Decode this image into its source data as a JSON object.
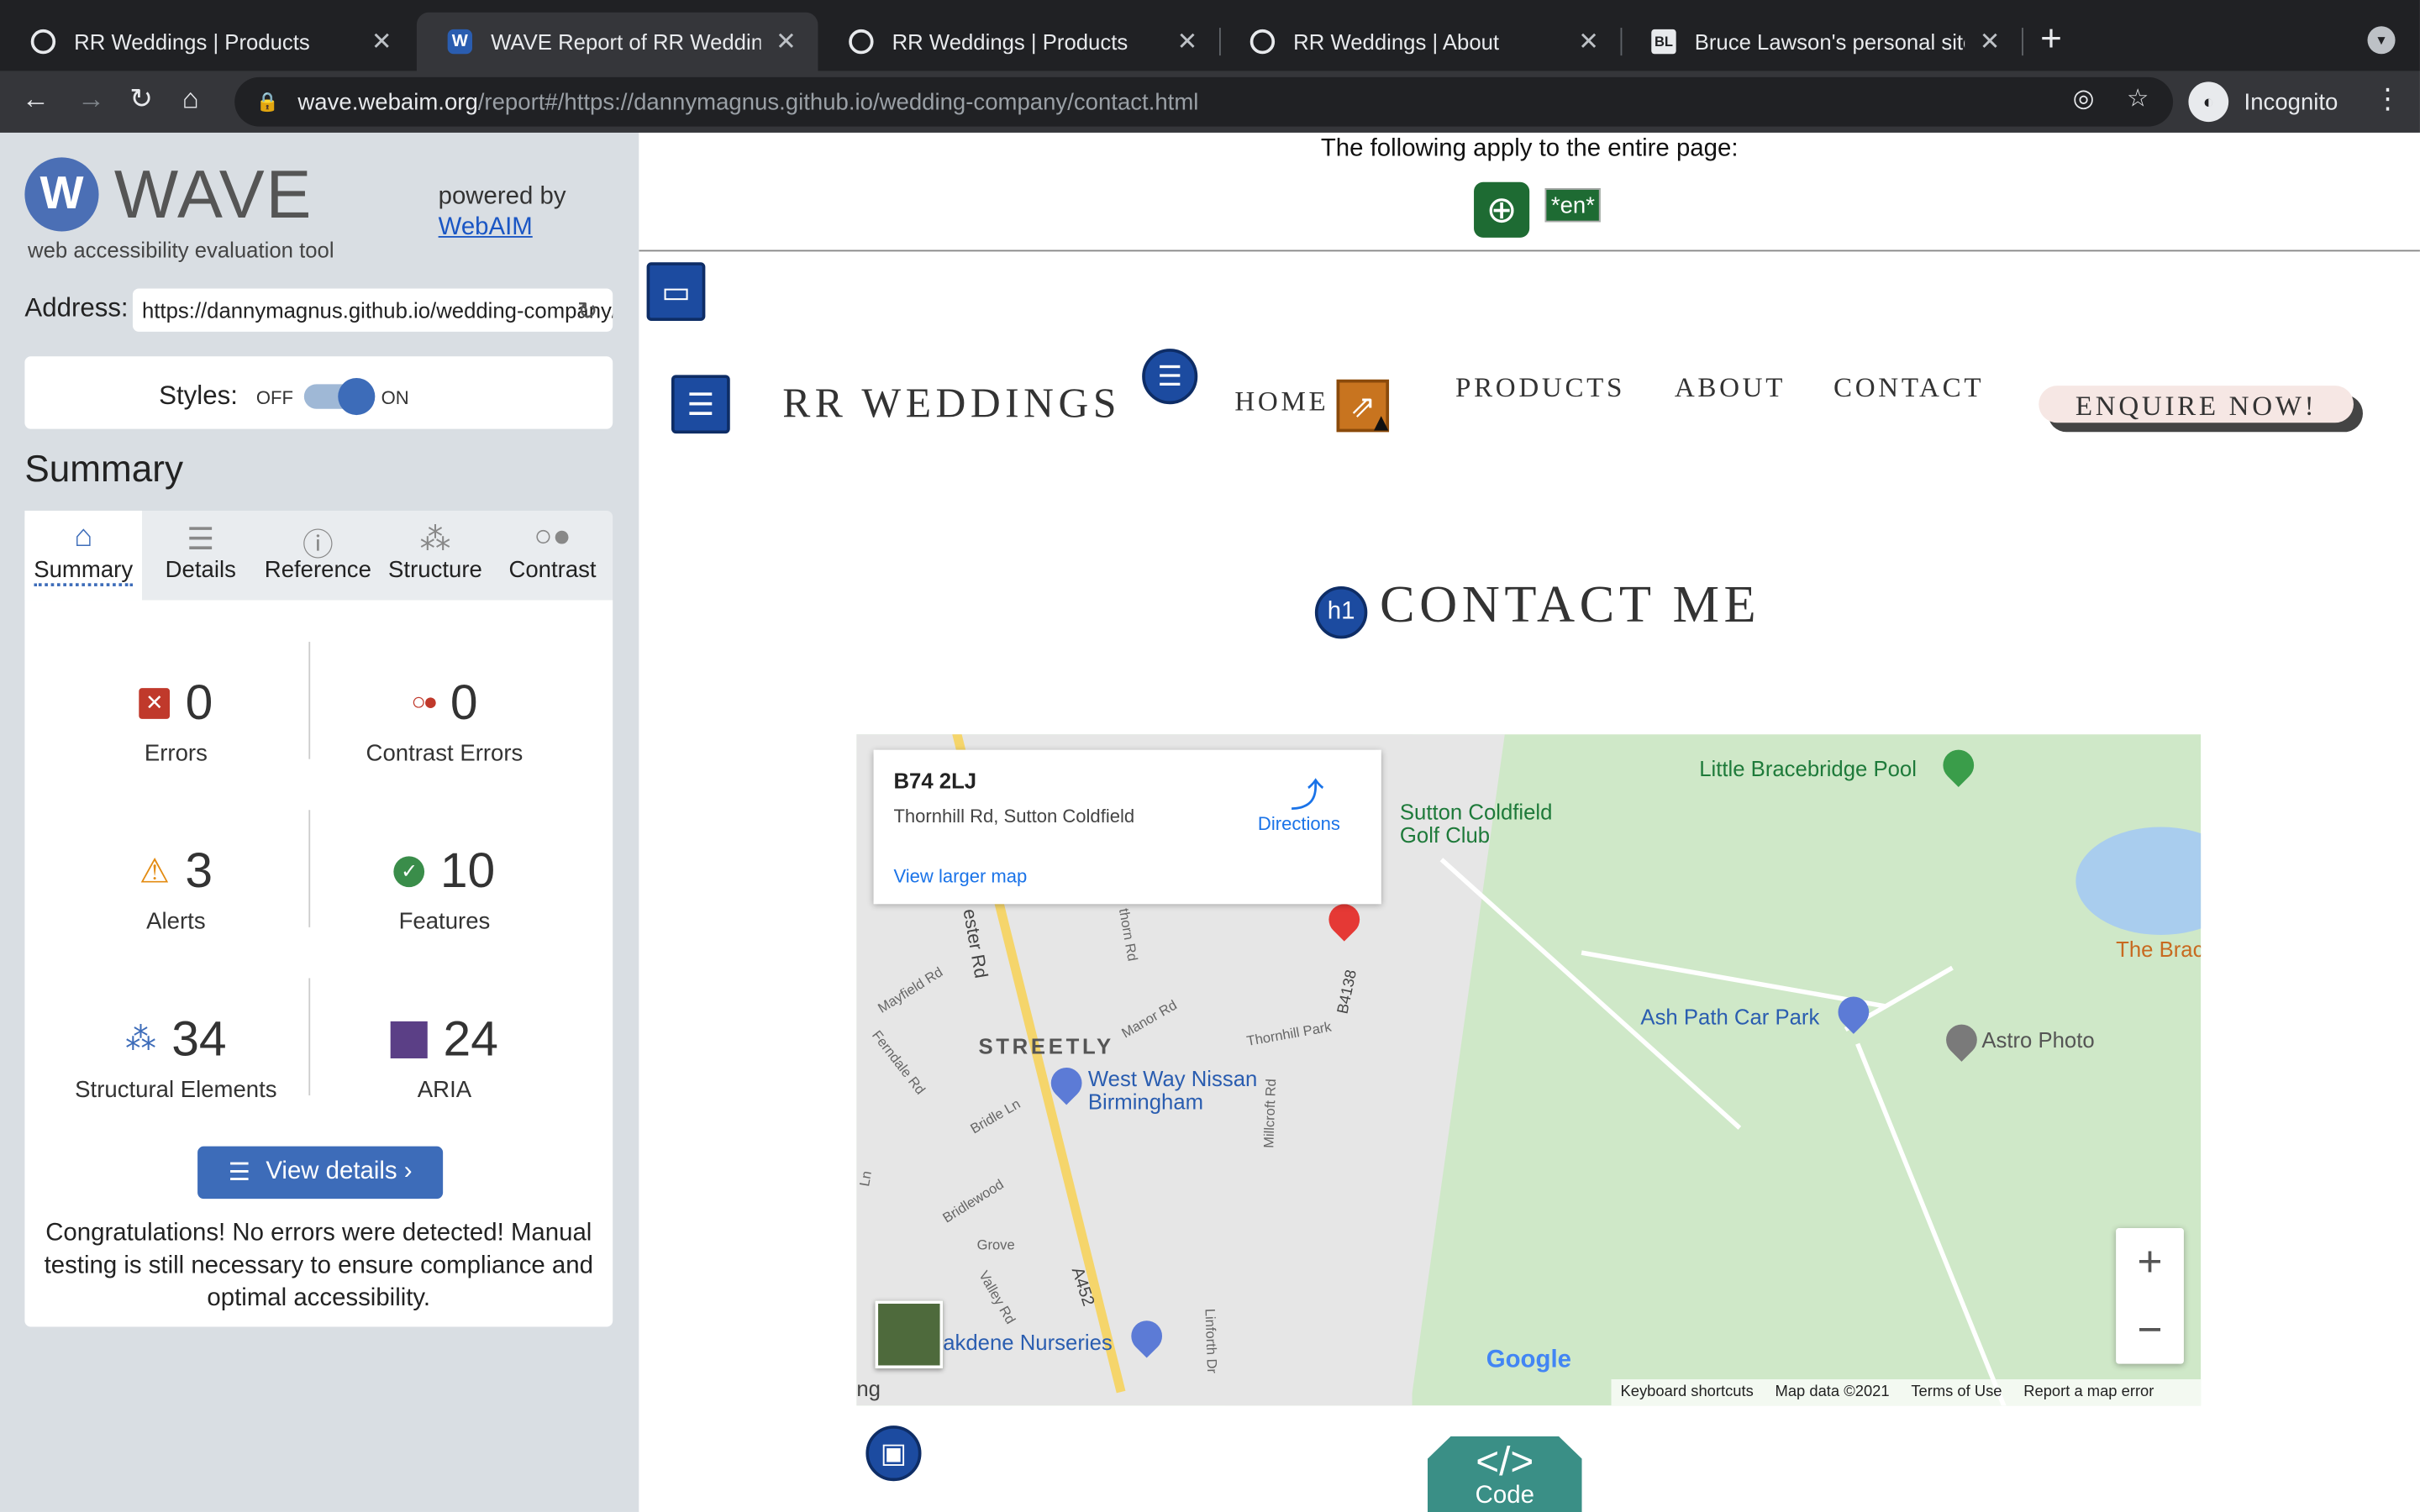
{
  "browser": {
    "tabs": [
      {
        "title": "RR Weddings | Products",
        "favicon": "globe-icon"
      },
      {
        "title": "WAVE Report of RR Weddings |",
        "favicon": "wave-icon"
      },
      {
        "title": "RR Weddings | Products",
        "favicon": "globe-icon"
      },
      {
        "title": "RR Weddings | About",
        "favicon": "globe-icon"
      },
      {
        "title": "Bruce Lawson's personal site",
        "favicon": "bl-icon"
      }
    ],
    "url_host": "wave.webaim.org",
    "url_path": "/report#/https://dannymagnus.github.io/wedding-company/contact.html",
    "profile_label": "Incognito"
  },
  "wave": {
    "title": "WAVE",
    "subtitle": "web accessibility evaluation tool",
    "powered_by": "powered by",
    "webaim_link": "WebAIM",
    "address_label": "Address:",
    "address_value": "https://dannymagnus.github.io/wedding-company/contact.html",
    "styles_label": "Styles:",
    "styles_off": "OFF",
    "styles_on": "ON",
    "summary_heading": "Summary",
    "tabs": [
      "Summary",
      "Details",
      "Reference",
      "Structure",
      "Contrast"
    ],
    "stats": {
      "errors": {
        "value": "0",
        "label": "Errors"
      },
      "contrast_errors": {
        "value": "0",
        "label": "Contrast Errors"
      },
      "alerts": {
        "value": "3",
        "label": "Alerts"
      },
      "features": {
        "value": "10",
        "label": "Features"
      },
      "structural": {
        "value": "34",
        "label": "Structural Elements"
      },
      "aria": {
        "value": "24",
        "label": "ARIA"
      }
    },
    "view_details": "View details ›",
    "congrats": "Congratulations! No errors were detected! Manual testing is still necessary to ensure compliance and optimal accessibility."
  },
  "page": {
    "apply_text": "The following apply to the entire page:",
    "lang_badge": "*en*",
    "brand": "RR WEDDINGS",
    "nav": [
      "HOME",
      "PRODUCTS",
      "ABOUT",
      "CONTACT"
    ],
    "enquire": "ENQUIRE NOW!",
    "heading": "CONTACT ME",
    "h1_badge": "h1",
    "code_label": "Code",
    "code_symbol": "</>"
  },
  "map": {
    "infobox_title": "B74 2LJ",
    "infobox_address": "Thornhill Rd, Sutton Coldfield",
    "directions": "Directions",
    "view_larger": "View larger map",
    "labels": {
      "pool": "Little Bracebridge Pool",
      "golf1": "Sutton Coldfield",
      "golf2": "Golf Club",
      "brac": "The Brac",
      "carpark": "Ash Path Car Park",
      "astro": "Astro Photo",
      "streetly": "STREETLY",
      "nissan1": "West Way Nissan",
      "nissan2": "Birmingham",
      "nurseries": "akdene Nurseries",
      "chester": "ester Rd",
      "b4138": "B4138",
      "a452": "A452",
      "manor": "Manor Rd",
      "thornhill_park": "Thornhill Park",
      "mayfield": "Mayfield Rd",
      "ferndale": "Ferndale Rd",
      "bridle": "Bridle Ln",
      "bridlewood": "Bridlewood",
      "grove": "Grove",
      "valley": "Valley Rd",
      "millcroft": "Millcroft Rd",
      "linforth": "Linforth Dr",
      "thorn": "thorn Rd",
      "ng": "ng",
      "ln": "Ln"
    },
    "google": "Google",
    "footer": [
      "Keyboard shortcuts",
      "Map data ©2021",
      "Terms of Use",
      "Report a map error"
    ]
  }
}
